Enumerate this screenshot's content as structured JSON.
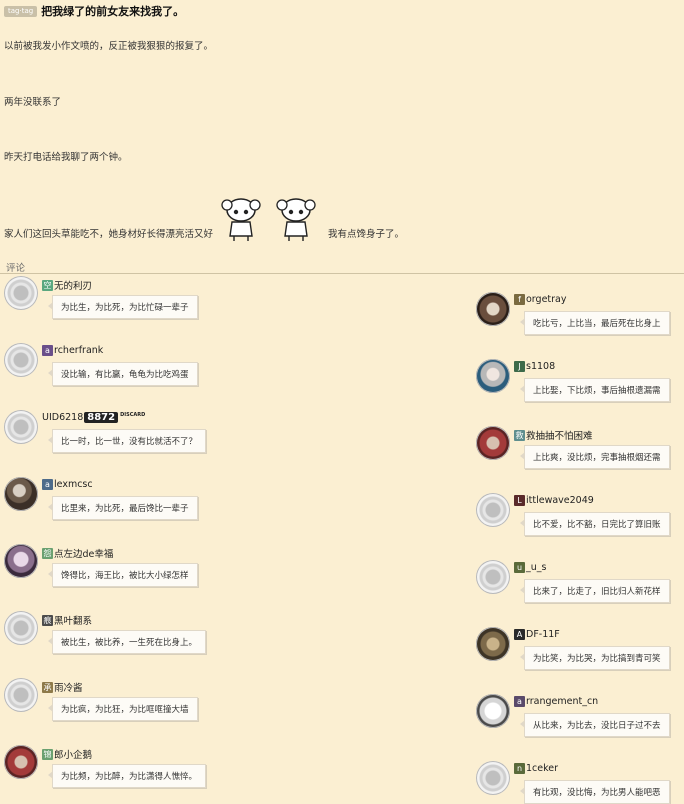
{
  "post": {
    "tag": "tag·tag",
    "title": "把我绿了的前女友来找我了。",
    "lines": [
      "以前被我发小作文喷的，反正被我狠狠的报复了。",
      "两年没联系了",
      "昨天打电话给我聊了两个钟。",
      "家人们这回头草能吃不，她身材好长得漂亮活又好"
    ],
    "line_after_stickers": "我有点馋身子了。",
    "stickers": [
      "anime-girl-sticker",
      "anime-girl-sticker"
    ]
  },
  "comments_label": "评论",
  "comments_left": [
    {
      "initial": "空",
      "initial_color": "#5aa77f",
      "name": "无的利刃",
      "text": "为比生，为比死，为比忙碌一辈子",
      "avatar": "default"
    },
    {
      "initial": "a",
      "initial_color": "#6a4f8a",
      "name": "rcherfrank",
      "text": "没比输，有比赢，龟龟为比吃鸡蛋",
      "avatar": "default"
    },
    {
      "initial": "",
      "initial_color": "",
      "name": "UID6218",
      "badge": "8872",
      "suffix": "DISCARD",
      "text": "比一时，比一世，没有比就活不了？",
      "avatar": "default"
    },
    {
      "initial": "a",
      "initial_color": "#4d6b8a",
      "name": "lexmcsc",
      "text": "比里来，为比死，最后馋比一辈子",
      "avatar": "photo p1"
    },
    {
      "initial": "怨",
      "initial_color": "#6aa070",
      "name": "点左边de幸福",
      "text": "馋得比，海王比，被比大小绿怎样",
      "avatar": "photo p2"
    },
    {
      "initial": "痕",
      "initial_color": "#4c4c4c",
      "name": "黑叶翻系",
      "text": "被比生，被比养，一生死在比身上。",
      "avatar": "default"
    },
    {
      "initial": "承",
      "initial_color": "#8e7a4a",
      "name": "雨冷酱",
      "text": "为比疯，为比狂，为比哐哐撞大墙",
      "avatar": "default"
    },
    {
      "initial": "锦",
      "initial_color": "#6aa070",
      "name": "郎小企鹅",
      "text": "为比频，为比醉，为比潇得人憔悴。",
      "avatar": "photo p4"
    }
  ],
  "comments_right": [
    {
      "initial": "f",
      "initial_color": "#7a6a40",
      "name": "orgetray",
      "text": "吃比亏，上比当，最后死在比身上",
      "avatar": "photo p7"
    },
    {
      "initial": "J",
      "initial_color": "#3d6a4a",
      "name": "s1108",
      "text": "上比娶，下比烦，事后抽根遗漏需",
      "avatar": "photo p3"
    },
    {
      "initial": "救",
      "initial_color": "#5e8e8e",
      "name": "救抽抽不怕困难",
      "text": "上比爽，没比烦，完事抽根烟还需",
      "avatar": "photo p4"
    },
    {
      "initial": "L",
      "initial_color": "#5a2a2a",
      "name": "ittlewave2049",
      "text": "比不爱，比不豁，日完比了算旧账",
      "avatar": "default"
    },
    {
      "initial": "u",
      "initial_color": "#5a6a3a",
      "name": "_u_s",
      "text": "比来了，比走了，旧比归人新花样",
      "avatar": "default"
    },
    {
      "initial": "A",
      "initial_color": "#2a2a2a",
      "name": "DF-11F",
      "text": "为比笑，为比哭，为比搞到青可笑",
      "avatar": "photo p6"
    },
    {
      "initial": "a",
      "initial_color": "#5a4a6a",
      "name": "rrangement_cn",
      "text": "从比来，为比去，没比日子过不去",
      "avatar": "photo p5"
    },
    {
      "initial": "n",
      "initial_color": "#5a6a3a",
      "name": "1ceker",
      "text": "有比观，没比悔，为比男人能吧恶",
      "avatar": "default"
    }
  ]
}
